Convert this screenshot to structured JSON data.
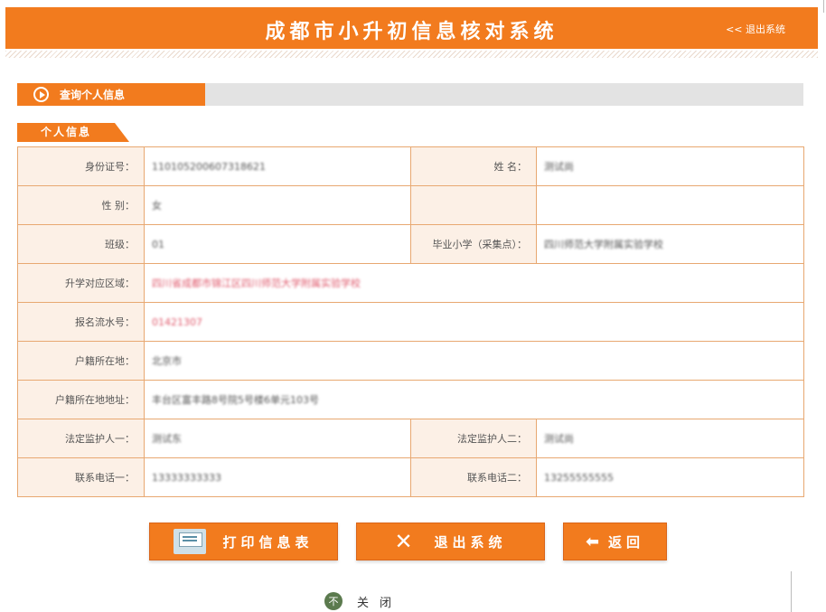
{
  "header": {
    "title": "成都市小升初信息核对系统",
    "logout_link": "<< 退出系统"
  },
  "query_tab": {
    "label": "查询个人信息"
  },
  "section_tab": {
    "label": "个人信息"
  },
  "fields": {
    "id_number": {
      "label": "身份证号：",
      "value": "110105200607318621"
    },
    "name": {
      "label": "姓 名：",
      "value": "测试尚"
    },
    "gender": {
      "label": "性 别：",
      "value": "女"
    },
    "class": {
      "label": "班级：",
      "value": "01"
    },
    "graduated_school": {
      "label": "毕业小学（采集点）：",
      "value": "四川师范大学附属实验学校"
    },
    "admission_area": {
      "label": "升学对应区域：",
      "value": "四川省成都市锦江区四川师范大学附属实验学校"
    },
    "registration_serial": {
      "label": "报名流水号：",
      "value": "01421307"
    },
    "household_location": {
      "label": "户籍所在地：",
      "value": "北京市"
    },
    "household_address": {
      "label": "户籍所在地地址：",
      "value": "丰台区富丰路8号院5号楼6单元103号"
    },
    "guardian_one": {
      "label": "法定监护人一：",
      "value": "测试东"
    },
    "guardian_two": {
      "label": "法定监护人二：",
      "value": "测试尚"
    },
    "phone_one": {
      "label": "联系电话一：",
      "value": "13333333333"
    },
    "phone_two": {
      "label": "联系电话二：",
      "value": "13255555555"
    }
  },
  "buttons": {
    "print": "打印信息表",
    "exit": "退出系统",
    "back": "返回",
    "back_arrow": "⬅",
    "exit_x": "✕"
  },
  "close": {
    "icon": "不",
    "label": "关闭"
  },
  "colors": {
    "accent": "#f27b1e",
    "label_bg": "#fcf0e6",
    "border": "#e8a871",
    "highlight_text": "#e05b6e",
    "close_icon": "#5b7a4e"
  }
}
